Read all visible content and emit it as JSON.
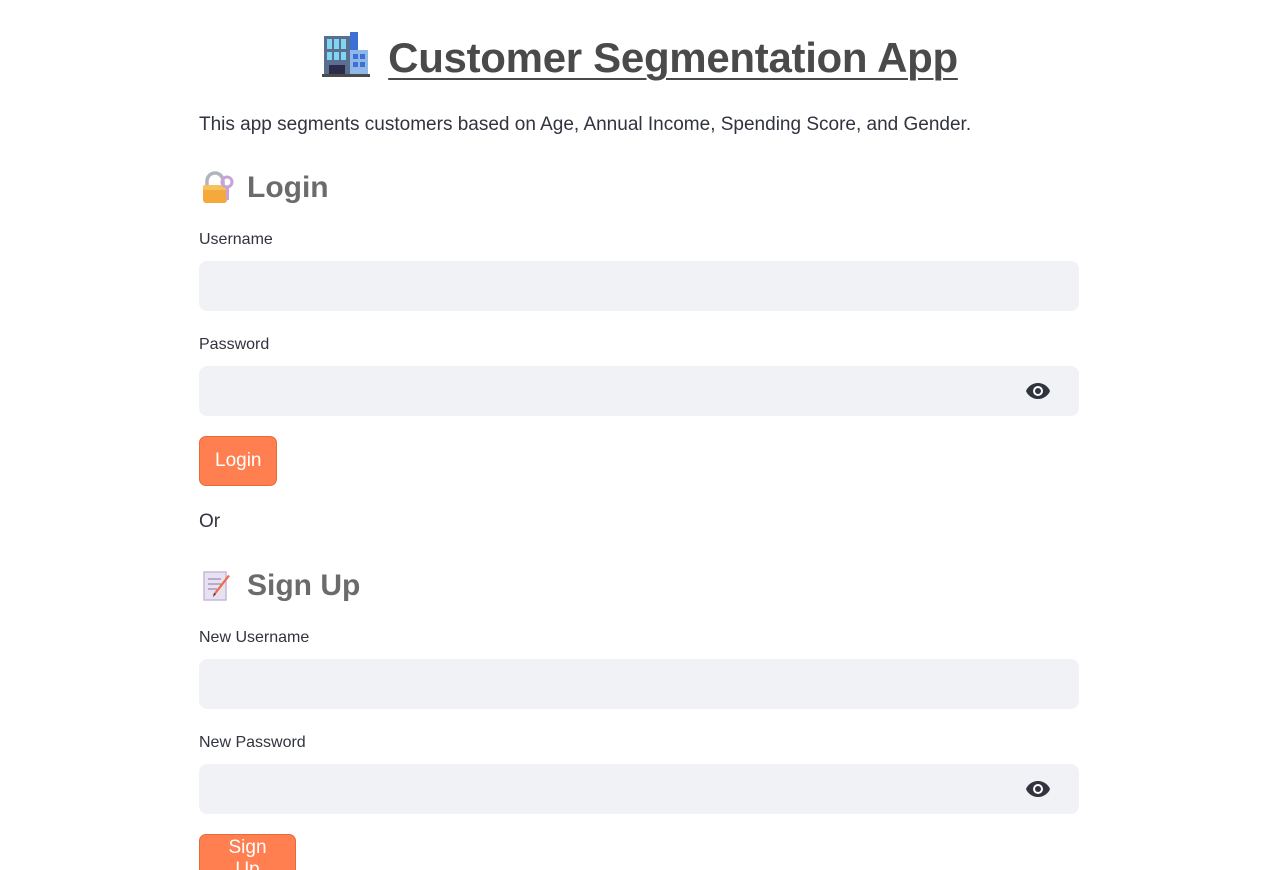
{
  "header": {
    "title": "Customer Segmentation App",
    "title_icon": "office-building-icon",
    "description": "This app segments customers based on Age, Annual Income, Spending Score, and Gender."
  },
  "login": {
    "heading": "Login",
    "heading_icon": "locked-with-key-icon",
    "username_label": "Username",
    "username_value": "",
    "password_label": "Password",
    "password_value": "",
    "button_label": "Login"
  },
  "separator_text": "Or",
  "signup": {
    "heading": "Sign Up",
    "heading_icon": "memo-icon",
    "username_label": "New Username",
    "username_value": "",
    "password_label": "New Password",
    "password_value": "",
    "button_label": "Sign Up"
  },
  "colors": {
    "button_bg": "#ff7f50",
    "input_bg": "#f0f2f6",
    "heading": "#6b6b6b"
  }
}
